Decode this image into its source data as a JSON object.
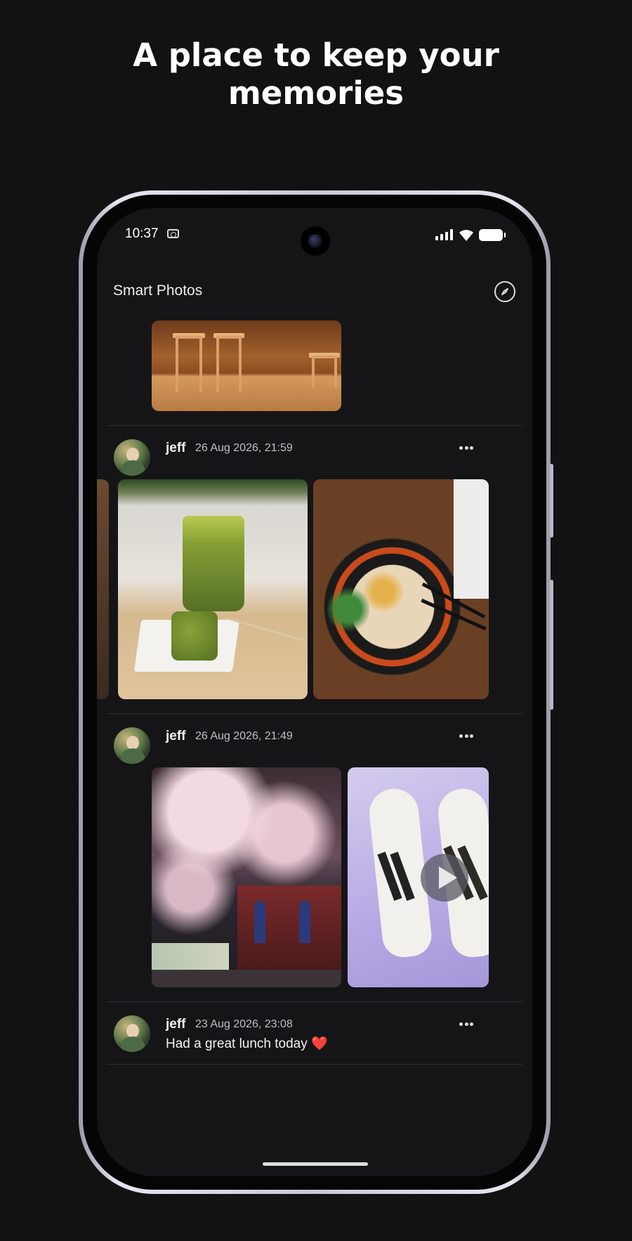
{
  "headline": {
    "line1": "A place to keep your",
    "line2": "memories"
  },
  "status_bar": {
    "time": "10:37"
  },
  "app_bar": {
    "title": "Smart Photos",
    "action_icon": "compass-icon"
  },
  "posts": [
    {
      "user": "jeff",
      "date": "26 Aug 2026, 21:59",
      "photos": [
        "matcha drink and matcha cake",
        "ramen bowl"
      ]
    },
    {
      "user": "jeff",
      "date": "26 Aug 2026, 21:49",
      "photos": [
        "cherry blossoms at night",
        "adidas sneakers video"
      ]
    },
    {
      "user": "jeff",
      "date": "23 Aug 2026, 23:08",
      "text": "Had a great lunch today ❤️"
    }
  ],
  "colors": {
    "background": "#121212",
    "screen": "#151518",
    "divider": "#2f2f34"
  }
}
